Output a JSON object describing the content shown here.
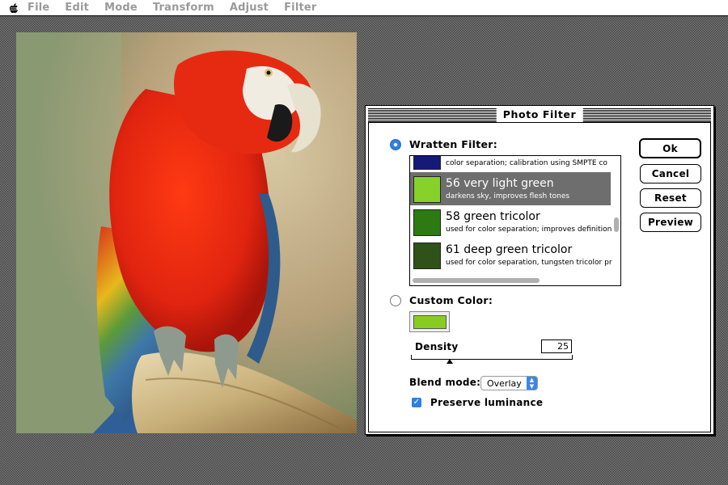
{
  "menubar": {
    "apple": "apple-logo-icon",
    "items": [
      "File",
      "Edit",
      "Mode",
      "Transform",
      "Adjust",
      "Filter"
    ]
  },
  "dialog": {
    "title": "Photo Filter",
    "wratten_label": "Wratten Filter:",
    "wratten_selected": true,
    "filters": [
      {
        "name": "",
        "desc": "color separation; calibration using SMPTE co",
        "color": "#141a78",
        "selected": false
      },
      {
        "name": "56 very light green",
        "desc": "darkens sky, improves flesh tones",
        "color": "#86d22a",
        "selected": true
      },
      {
        "name": "58 green tricolor",
        "desc": "used for color separation; improves definition",
        "color": "#2e7a12",
        "selected": false
      },
      {
        "name": "61 deep green tricolor",
        "desc": "used for color separation, tungsten tricolor pr",
        "color": "#2f5219",
        "selected": false
      }
    ],
    "custom_label": "Custom Color:",
    "custom_selected": false,
    "custom_color": "#88cc22",
    "density_label": "Density",
    "density_value": "25",
    "blend_label": "Blend mode:",
    "blend_value": "Overlay",
    "preserve_label": "Preserve luminance",
    "preserve_checked": true,
    "check_glyph": "✓",
    "buttons": {
      "ok": "Ok",
      "cancel": "Cancel",
      "reset": "Reset",
      "preview": "Preview"
    }
  }
}
